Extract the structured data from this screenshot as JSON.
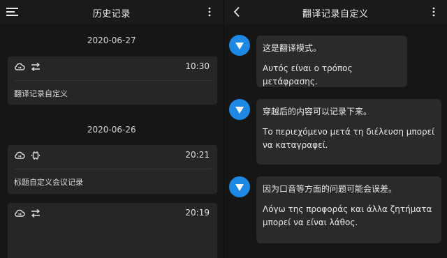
{
  "left": {
    "title": "历史记录",
    "groups": [
      {
        "date": "2020-06-27",
        "items": [
          {
            "time": "10:30",
            "label": "翻译记录自定义",
            "icon2": "swap-arrows-icon"
          }
        ]
      },
      {
        "date": "2020-06-26",
        "items": [
          {
            "time": "20:21",
            "label": "标题自定义会议记录",
            "icon2": "meeting-device-icon"
          },
          {
            "time": "20:19",
            "label": "",
            "icon2": "swap-arrows-icon"
          }
        ]
      }
    ]
  },
  "right": {
    "title": "翻译记录自定义",
    "messages": [
      {
        "zh": "这是翻译模式。",
        "el_lines": [
          "Αυτός είναι ο τρόπος μετάφρασης."
        ]
      },
      {
        "zh": "穿越后的内容可以记录下来。",
        "el_lines": [
          "Το περιεχόμενο μετά τη διέλευση μπορεί",
          "να καταγραφεί."
        ]
      },
      {
        "zh": "因为口音等方面的问题可能会误差。",
        "el_lines": [
          "Λόγω της προφοράς και άλλα ζητήματα",
          "μπορεί να είναι λάθος."
        ]
      }
    ]
  },
  "colors": {
    "background": "#161616",
    "card": "#262626",
    "bubble": "#2a2a2a",
    "avatar": "#1e88e5"
  },
  "icons": [
    "menu-icon",
    "more-vert-icon",
    "back-arrow-icon",
    "cloud-sync-icon",
    "swap-arrows-icon",
    "meeting-device-icon",
    "avatar-icon"
  ]
}
